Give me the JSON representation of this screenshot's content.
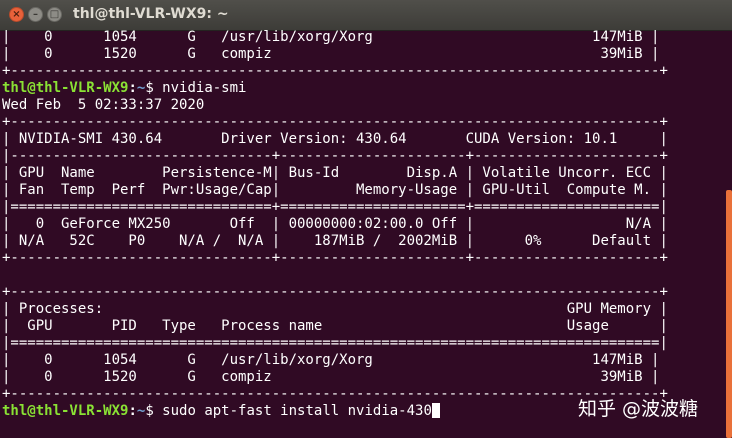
{
  "window": {
    "title": "thl@thl-VLR-WX9: ~",
    "close_glyph": "×",
    "minimize_glyph": "–",
    "maximize_glyph": "□"
  },
  "prompt": {
    "user_host": "thl@thl-VLR-WX9",
    "colon": ":",
    "path": "~",
    "symbol": "$ "
  },
  "lines": {
    "l1": "|    0      1054      G   /usr/lib/xorg/Xorg                          147MiB |",
    "l2": "|    0      1520      G   compiz                                       39MiB |",
    "l3": "+-----------------------------------------------------------------------------+",
    "cmd1": "nvidia-smi",
    "l5": "Wed Feb  5 02:33:37 2020",
    "l6": "+-----------------------------------------------------------------------------+",
    "l7": "| NVIDIA-SMI 430.64       Driver Version: 430.64       CUDA Version: 10.1     |",
    "l8": "|-------------------------------+----------------------+----------------------+",
    "l9": "| GPU  Name        Persistence-M| Bus-Id        Disp.A | Volatile Uncorr. ECC |",
    "l10": "| Fan  Temp  Perf  Pwr:Usage/Cap|         Memory-Usage | GPU-Util  Compute M. |",
    "l11": "|===============================+======================+======================|",
    "l12": "|   0  GeForce MX250       Off  | 00000000:02:00.0 Off |                  N/A |",
    "l13": "| N/A   52C    P0    N/A /  N/A |    187MiB /  2002MiB |      0%      Default |",
    "l14": "+-------------------------------+----------------------+----------------------+",
    "l15": "",
    "l16": "+-----------------------------------------------------------------------------+",
    "l17": "| Processes:                                                       GPU Memory |",
    "l18": "|  GPU       PID   Type   Process name                             Usage      |",
    "l19": "|=============================================================================|",
    "l20": "|    0      1054      G   /usr/lib/xorg/Xorg                          147MiB |",
    "l21": "|    0      1520      G   compiz                                       39MiB |",
    "l22": "+-----------------------------------------------------------------------------+",
    "cmd2": "sudo apt-fast install nvidia-430"
  },
  "watermark": "知乎 @波波糖",
  "colors": {
    "background": "#300a24",
    "prompt_user": "#8ae234",
    "prompt_path": "#729fcf",
    "scrollbar": "#e9713a"
  }
}
